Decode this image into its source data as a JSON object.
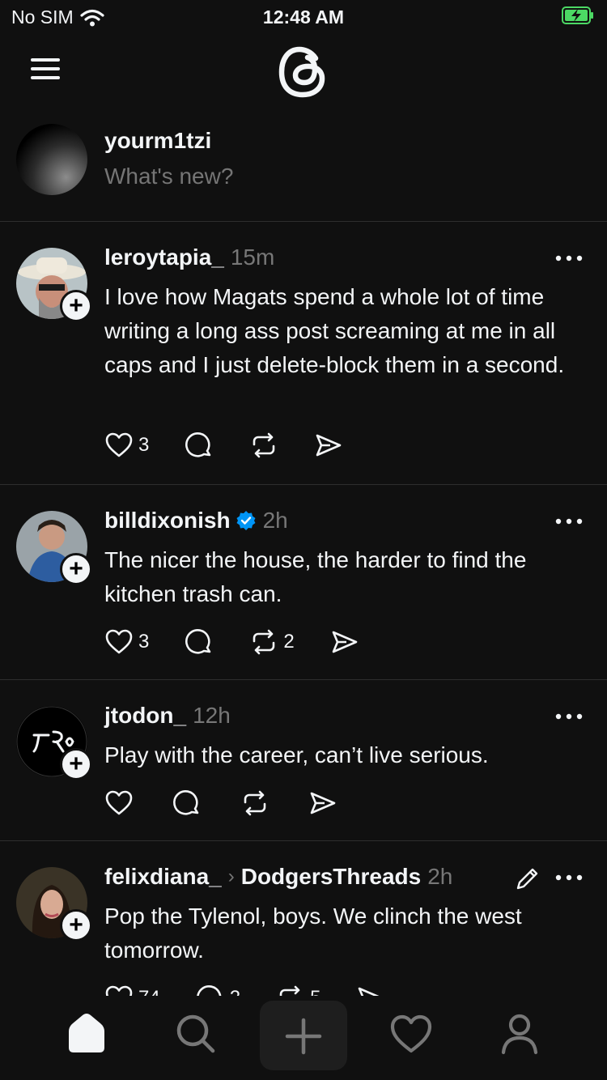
{
  "status": {
    "carrier": "No SIM",
    "time": "12:48 AM"
  },
  "composer": {
    "username": "yourm1tzi",
    "placeholder": "What's new?"
  },
  "posts": [
    {
      "username": "leroytapia_",
      "time": "15m",
      "verified": false,
      "text": "I love how Magats spend a whole lot of time writing a long ass post screaming at me in all caps and I just delete-block them in a second.",
      "likes": "3",
      "replies": "",
      "reposts": ""
    },
    {
      "username": "billdixonish",
      "time": "2h",
      "verified": true,
      "text": "The nicer the house, the harder to find the kitchen trash can.",
      "likes": "3",
      "replies": "",
      "reposts": "2"
    },
    {
      "username": "jtodon_",
      "time": "12h",
      "verified": false,
      "text": "Play with the career, can’t live serious.",
      "likes": "",
      "replies": "",
      "reposts": ""
    },
    {
      "username": "felixdiana_",
      "community": "DodgersThreads",
      "time": "2h",
      "verified": false,
      "text": "Pop the Tylenol, boys. We clinch the west tomorrow.",
      "likes": "74",
      "replies": "2",
      "reposts": "5"
    }
  ],
  "icons": [
    "wifi-icon",
    "battery-icon",
    "menu-icon",
    "threads-logo-icon",
    "heart-icon",
    "reply-icon",
    "repost-icon",
    "share-icon",
    "more-icon",
    "verified-icon",
    "edit-icon",
    "home-icon",
    "search-icon",
    "create-icon",
    "activity-icon",
    "profile-icon"
  ],
  "colors": {
    "background": "#101010",
    "text": "#f3f5f7",
    "muted": "#777777",
    "verified": "#0095f6",
    "battery": "#4cd964"
  }
}
